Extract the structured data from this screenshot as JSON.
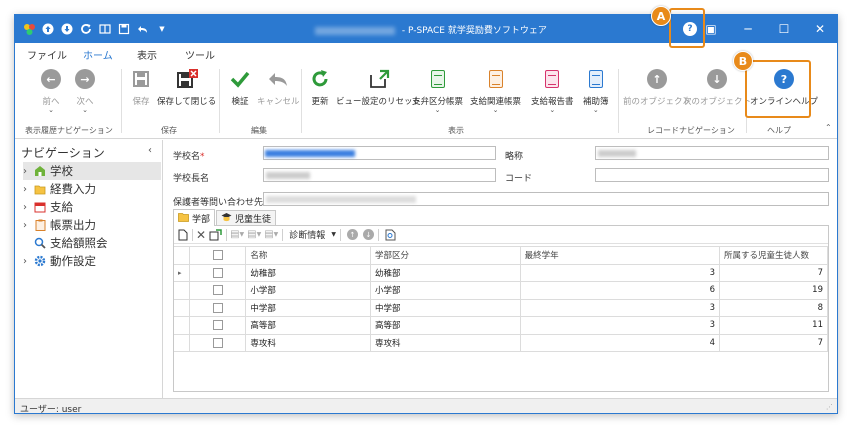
{
  "window": {
    "title": " - P-SPACE 就学奨励費ソフトウェア",
    "minimize": "─",
    "maximize": "☐",
    "close": "✕",
    "help_icon": "?",
    "layout_icon": "▣"
  },
  "ribbon_tabs": [
    "ファイル",
    "ホーム",
    "表示",
    "ツール"
  ],
  "ribbon": {
    "back": "前へ",
    "next": "次へ",
    "save": "保存",
    "save_close": "保存して閉じる",
    "verify": "検証",
    "cancel": "キャンセル",
    "refresh": "更新",
    "view_reset": "ビュー設定のリセット",
    "payment_class_forms": "支弁区分帳票",
    "payment_related_forms": "支給関連帳票",
    "payment_report": "支給報告書",
    "aux_ledger": "補助簿",
    "prev_object": "前のオブジェクト",
    "next_object": "次のオブジェクト",
    "online_help": "オンラインヘルプ",
    "groups": {
      "history_nav": "表示履歴ナビゲーション",
      "save": "保存",
      "edit": "編集",
      "display": "表示",
      "record_nav": "レコードナビゲーション",
      "help": "ヘルプ"
    }
  },
  "navigation": {
    "header": "ナビゲーション",
    "items": [
      "学校",
      "経費入力",
      "支給",
      "帳票出力",
      "支給額照会",
      "動作設定"
    ]
  },
  "form": {
    "school_name_label": "学校名",
    "required_mark": "*",
    "abbrev_label": "略称",
    "principal_label": "学校長名",
    "code_label": "コード",
    "guardian_contact_label": "保護者等問い合わせ先"
  },
  "subtabs": [
    "学部",
    "児童生徒"
  ],
  "grid": {
    "toolbar_diag": "診断情報",
    "columns": [
      "名称",
      "学部区分",
      "最終学年",
      "所属する児童生徒人数"
    ],
    "rows": [
      {
        "name": "幼稚部",
        "type": "幼稚部",
        "last_grade": "3",
        "count": "7"
      },
      {
        "name": "小学部",
        "type": "小学部",
        "last_grade": "6",
        "count": "19"
      },
      {
        "name": "中学部",
        "type": "中学部",
        "last_grade": "3",
        "count": "8"
      },
      {
        "name": "高等部",
        "type": "高等部",
        "last_grade": "3",
        "count": "11"
      },
      {
        "name": "専攻科",
        "type": "専攻科",
        "last_grade": "4",
        "count": "7"
      }
    ]
  },
  "status": {
    "user": "ユーザー: user"
  },
  "callouts": {
    "a": "A",
    "b": "B"
  },
  "colors": {
    "accent": "#2b79d0",
    "callout": "#e88a1a",
    "save_close_red": "#d9302c",
    "check_green": "#2e9a3a"
  }
}
